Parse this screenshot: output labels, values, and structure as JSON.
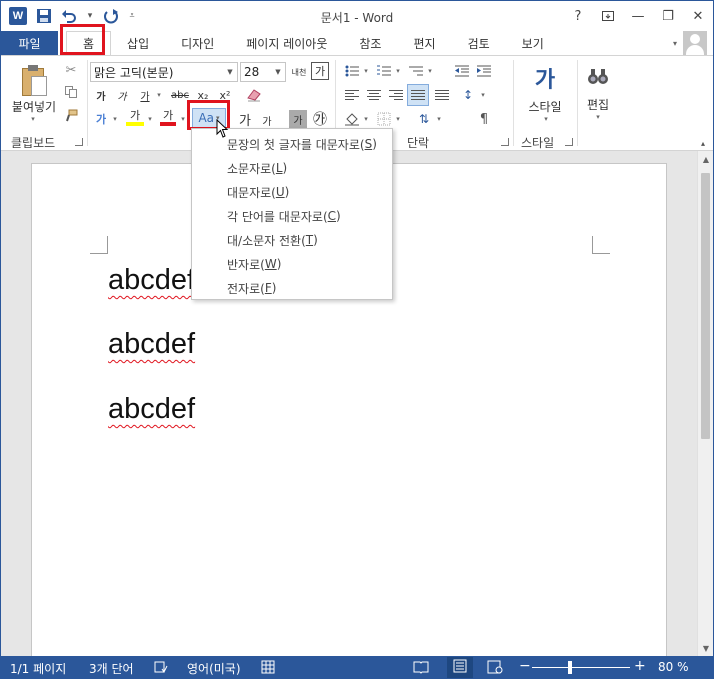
{
  "window": {
    "title": "문서1 - Word",
    "help": "?",
    "minimize": "—",
    "restore": "❐",
    "close": "✕",
    "app_icon": "W"
  },
  "qat": {
    "save_icon": "save-icon",
    "undo_icon": "undo-icon",
    "redo_icon": "redo-icon",
    "customize_icon": "customize-qat-icon"
  },
  "tabs": {
    "file": "파일",
    "home": "홈",
    "insert": "삽입",
    "design": "디자인",
    "layout": "페이지 레이아웃",
    "references": "참조",
    "mailings": "편지",
    "review": "검토",
    "view": "보기"
  },
  "ribbon": {
    "clipboard": {
      "paste": "붙여넣기",
      "label": "클립보드"
    },
    "font": {
      "name": "맑은 고딕(본문)",
      "size": "28",
      "bold": "가",
      "italic": "가",
      "underline": "가",
      "strike": "abc",
      "subscript": "x₂",
      "superscript": "x²",
      "effects": "가",
      "highlight": "가",
      "font_color": "가",
      "change_case": "Aa",
      "grow": "가",
      "shrink": "가",
      "phonetic": "내천",
      "enclose": "가",
      "char_border": "가",
      "char_shade": "가",
      "circle": "㉮"
    },
    "paragraph": {
      "label": "단락"
    },
    "styles": {
      "styles": "스타일",
      "label": "스타일",
      "style_glyph": "가"
    },
    "editing": {
      "editing": "편집"
    }
  },
  "change_case_menu": {
    "items": [
      {
        "text": "문장의 첫 글자를 대문자로(",
        "key": "S",
        "end": ")"
      },
      {
        "text": "소문자로(",
        "key": "L",
        "end": ")"
      },
      {
        "text": "대문자로(",
        "key": "U",
        "end": ")"
      },
      {
        "text": "각 단어를 대문자로(",
        "key": "C",
        "end": ")"
      },
      {
        "text": "대/소문자 전환(",
        "key": "T",
        "end": ")"
      },
      {
        "text": "반자로(",
        "key": "W",
        "end": ")"
      },
      {
        "text": "전자로(",
        "key": "F",
        "end": ")"
      }
    ]
  },
  "document": {
    "lines": [
      "abcdef",
      "abcdef",
      "abcdef"
    ]
  },
  "status": {
    "page": "1/1 페이지",
    "words": "3개 단어",
    "language": "영어(미국)",
    "zoom": "80 %",
    "zoom_minus": "−",
    "zoom_plus": "+",
    "zoom_value": 0.8
  },
  "colors": {
    "accent": "#2b579a",
    "highlight_red": "#e0141e"
  }
}
